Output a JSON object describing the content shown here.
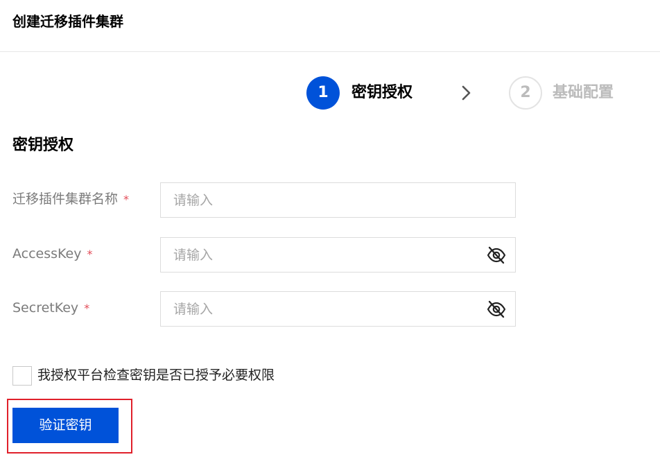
{
  "header": {
    "title": "创建迁移插件集群"
  },
  "steps": [
    {
      "number": "1",
      "label": "密钥授权",
      "state": "active"
    },
    {
      "number": "2",
      "label": "基础配置",
      "state": "inactive"
    }
  ],
  "section": {
    "title": "密钥授权"
  },
  "form": {
    "cluster_name": {
      "label": "迁移插件集群名称",
      "required_mark": "*",
      "placeholder": "请输入",
      "value": ""
    },
    "access_key": {
      "label": "AccessKey",
      "required_mark": "*",
      "placeholder": "请输入",
      "value": ""
    },
    "secret_key": {
      "label": "SecretKey",
      "required_mark": "*",
      "placeholder": "请输入",
      "value": ""
    }
  },
  "consent": {
    "label": "我授权平台检查密钥是否已授予必要权限",
    "checked": false
  },
  "actions": {
    "verify_label": "验证密钥"
  },
  "colors": {
    "primary": "#0052d9",
    "required": "#e34d59",
    "highlight": "#e0202a"
  }
}
